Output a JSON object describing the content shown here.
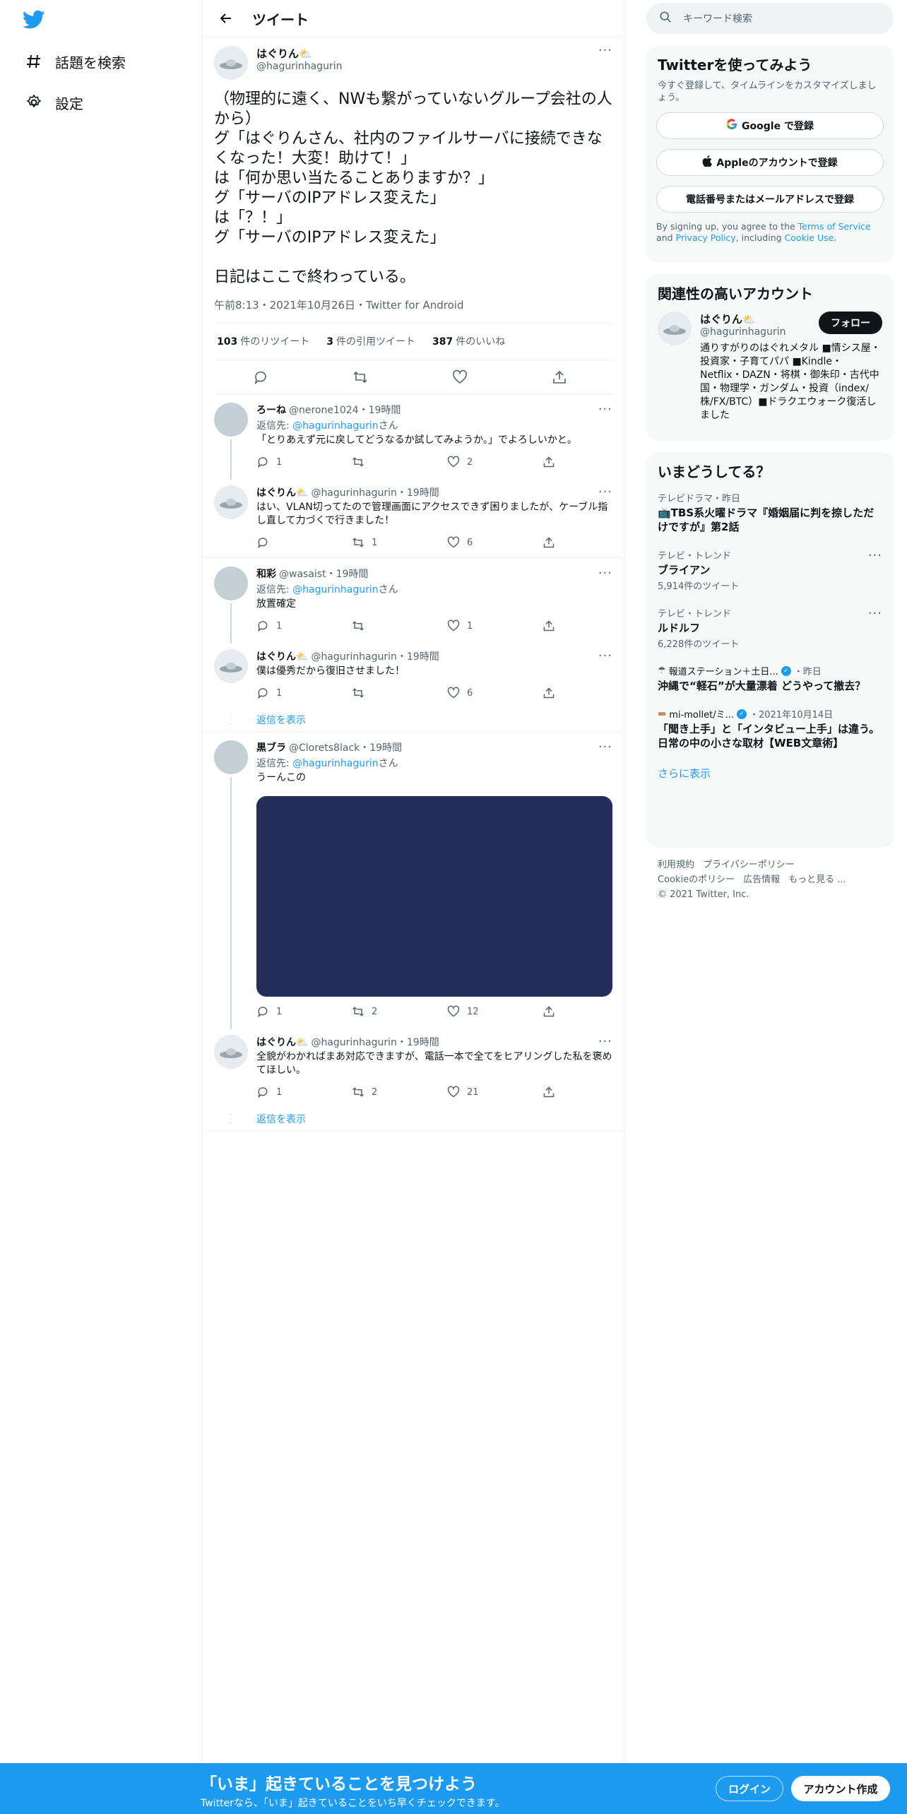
{
  "nav": {
    "explore_label": "話題を検索",
    "settings_label": "設定"
  },
  "header": {
    "title": "ツイート"
  },
  "focal": {
    "name": "はぐりん⛅",
    "handle": "@hagurinhagurin",
    "text": "（物理的に遠く、NWも繋がっていないグループ会社の人から）\nグ「はぐりんさん、社内のファイルサーバに接続できなくなった！大変！助けて！」\nは「何か思い当たることありますか？」\nグ「サーバのIPアドレス変えた」\nは「？！」\nグ「サーバのIPアドレス変えた」\n\n日記はここで終わっている。",
    "meta": "午前8:13・2021年10月26日・Twitter for Android",
    "retweets": "103",
    "retweets_label": "件のリツイート",
    "quotes": "3",
    "quotes_label": "件の引用ツイート",
    "likes": "387",
    "likes_label": "件のいいね"
  },
  "replies": [
    {
      "name": "ろーね",
      "handle": "@nerone1024・19時間",
      "reply_to_prefix": "返信先: ",
      "reply_to": "@hagurinhagurin",
      "reply_to_suffix": "さん",
      "text": "「とりあえず元に戻してどうなるか試してみようか。」でよろしいかと。",
      "replies": "1",
      "retweets": "",
      "likes": "2"
    },
    {
      "name": "はぐりん⛅",
      "handle": "@hagurinhagurin・19時間",
      "text": "はい、VLAN切ってたので管理画面にアクセスできず困りましたが、ケーブル指し直して力づくで行きました！",
      "replies": "",
      "retweets": "1",
      "likes": "6"
    },
    {
      "name": "和彩",
      "handle": "@wasaist・19時間",
      "reply_to_prefix": "返信先: ",
      "reply_to": "@hagurinhagurin",
      "reply_to_suffix": "さん",
      "text": "放置確定",
      "replies": "1",
      "retweets": "",
      "likes": "1"
    },
    {
      "name": "はぐりん⛅",
      "handle": "@hagurinhagurin・19時間",
      "text": "僕は優秀だから復旧させました！",
      "replies": "1",
      "retweets": "",
      "likes": "6"
    },
    {
      "name": "黒ブラ",
      "handle": "@Clorets8lack・19時間",
      "reply_to_prefix": "返信先: ",
      "reply_to": "@hagurinhagurin",
      "reply_to_suffix": "さん",
      "text": "うーんこの",
      "replies": "1",
      "retweets": "2",
      "likes": "12"
    },
    {
      "name": "はぐりん⛅",
      "handle": "@hagurinhagurin・19時間",
      "text": "全貌がわかればまあ対応できますが、電話一本で全てをヒアリングした私を褒めてほしい。",
      "replies": "1",
      "retweets": "2",
      "likes": "21"
    }
  ],
  "show_replies_label": "返信を表示",
  "search": {
    "placeholder": "キーワード検索"
  },
  "signup_card": {
    "title": "Twitterを使ってみよう",
    "subtitle": "今すぐ登録して、タイムラインをカスタマイズしましょう。",
    "google": "Google で登録",
    "apple": "Appleのアカウントで登録",
    "phone": "電話番号またはメールアドレスで登録",
    "terms_1": "By signing up, you agree to the ",
    "terms_link1": "Terms of Service",
    "terms_2": " and ",
    "terms_link2": "Privacy Policy",
    "terms_3": ", including ",
    "terms_link3": "Cookie Use",
    "terms_4": "."
  },
  "related": {
    "title": "関連性の高いアカウント",
    "name": "はぐりん⛅",
    "handle": "@hagurinhagurin",
    "follow": "フォロー",
    "bio": "通りすがりのはぐれメタル ■情シス屋・投資家・子育てパパ ■Kindle・Netflix・DAZN・将棋・御朱印・古代中国・物理学・ガンダム・投資（index/株/FX/BTC）■ドラクエウォーク復活しました"
  },
  "trends": {
    "title": "いまどうしてる？",
    "items": [
      {
        "context": "テレビドラマ・昨日",
        "name": "📺TBS系火曜ドラマ『婚姻届に判を捺しただけですが』第2話",
        "count": ""
      },
      {
        "context": "テレビ・トレンド",
        "name": "ブライアン",
        "count": "5,914件のツイート"
      },
      {
        "context": "テレビ・トレンド",
        "name": "ルドルフ",
        "count": "6,228件のツイート"
      },
      {
        "source": "報道ステーション＋土日...",
        "time": "・昨日",
        "name": "沖縄で“軽石”が大量漂着 どうやって撤去？"
      },
      {
        "source": "mi-mollet/ミ...",
        "time": "・2021年10月14日",
        "name": "「聞き上手」と「インタビュー上手」は違う。日常の中の小さな取材【WEB文章術】"
      }
    ],
    "show_more": "さらに表示"
  },
  "footer": {
    "terms": "利用規約",
    "privacy": "プライバシーポリシー",
    "cookie": "Cookieのポリシー",
    "ads": "広告情報",
    "more": "もっと見る ...",
    "copyright": "© 2021 Twitter, Inc."
  },
  "bottom_bar": {
    "title": "「いま」起きていることを見つけよう",
    "subtitle": "Twitterなら、「いま」起きていることをいち早くチェックできます。",
    "login": "ログイン",
    "signup": "アカウント作成"
  },
  "colors": {
    "accent": "#1d9bf0",
    "media": "#252e5b"
  }
}
